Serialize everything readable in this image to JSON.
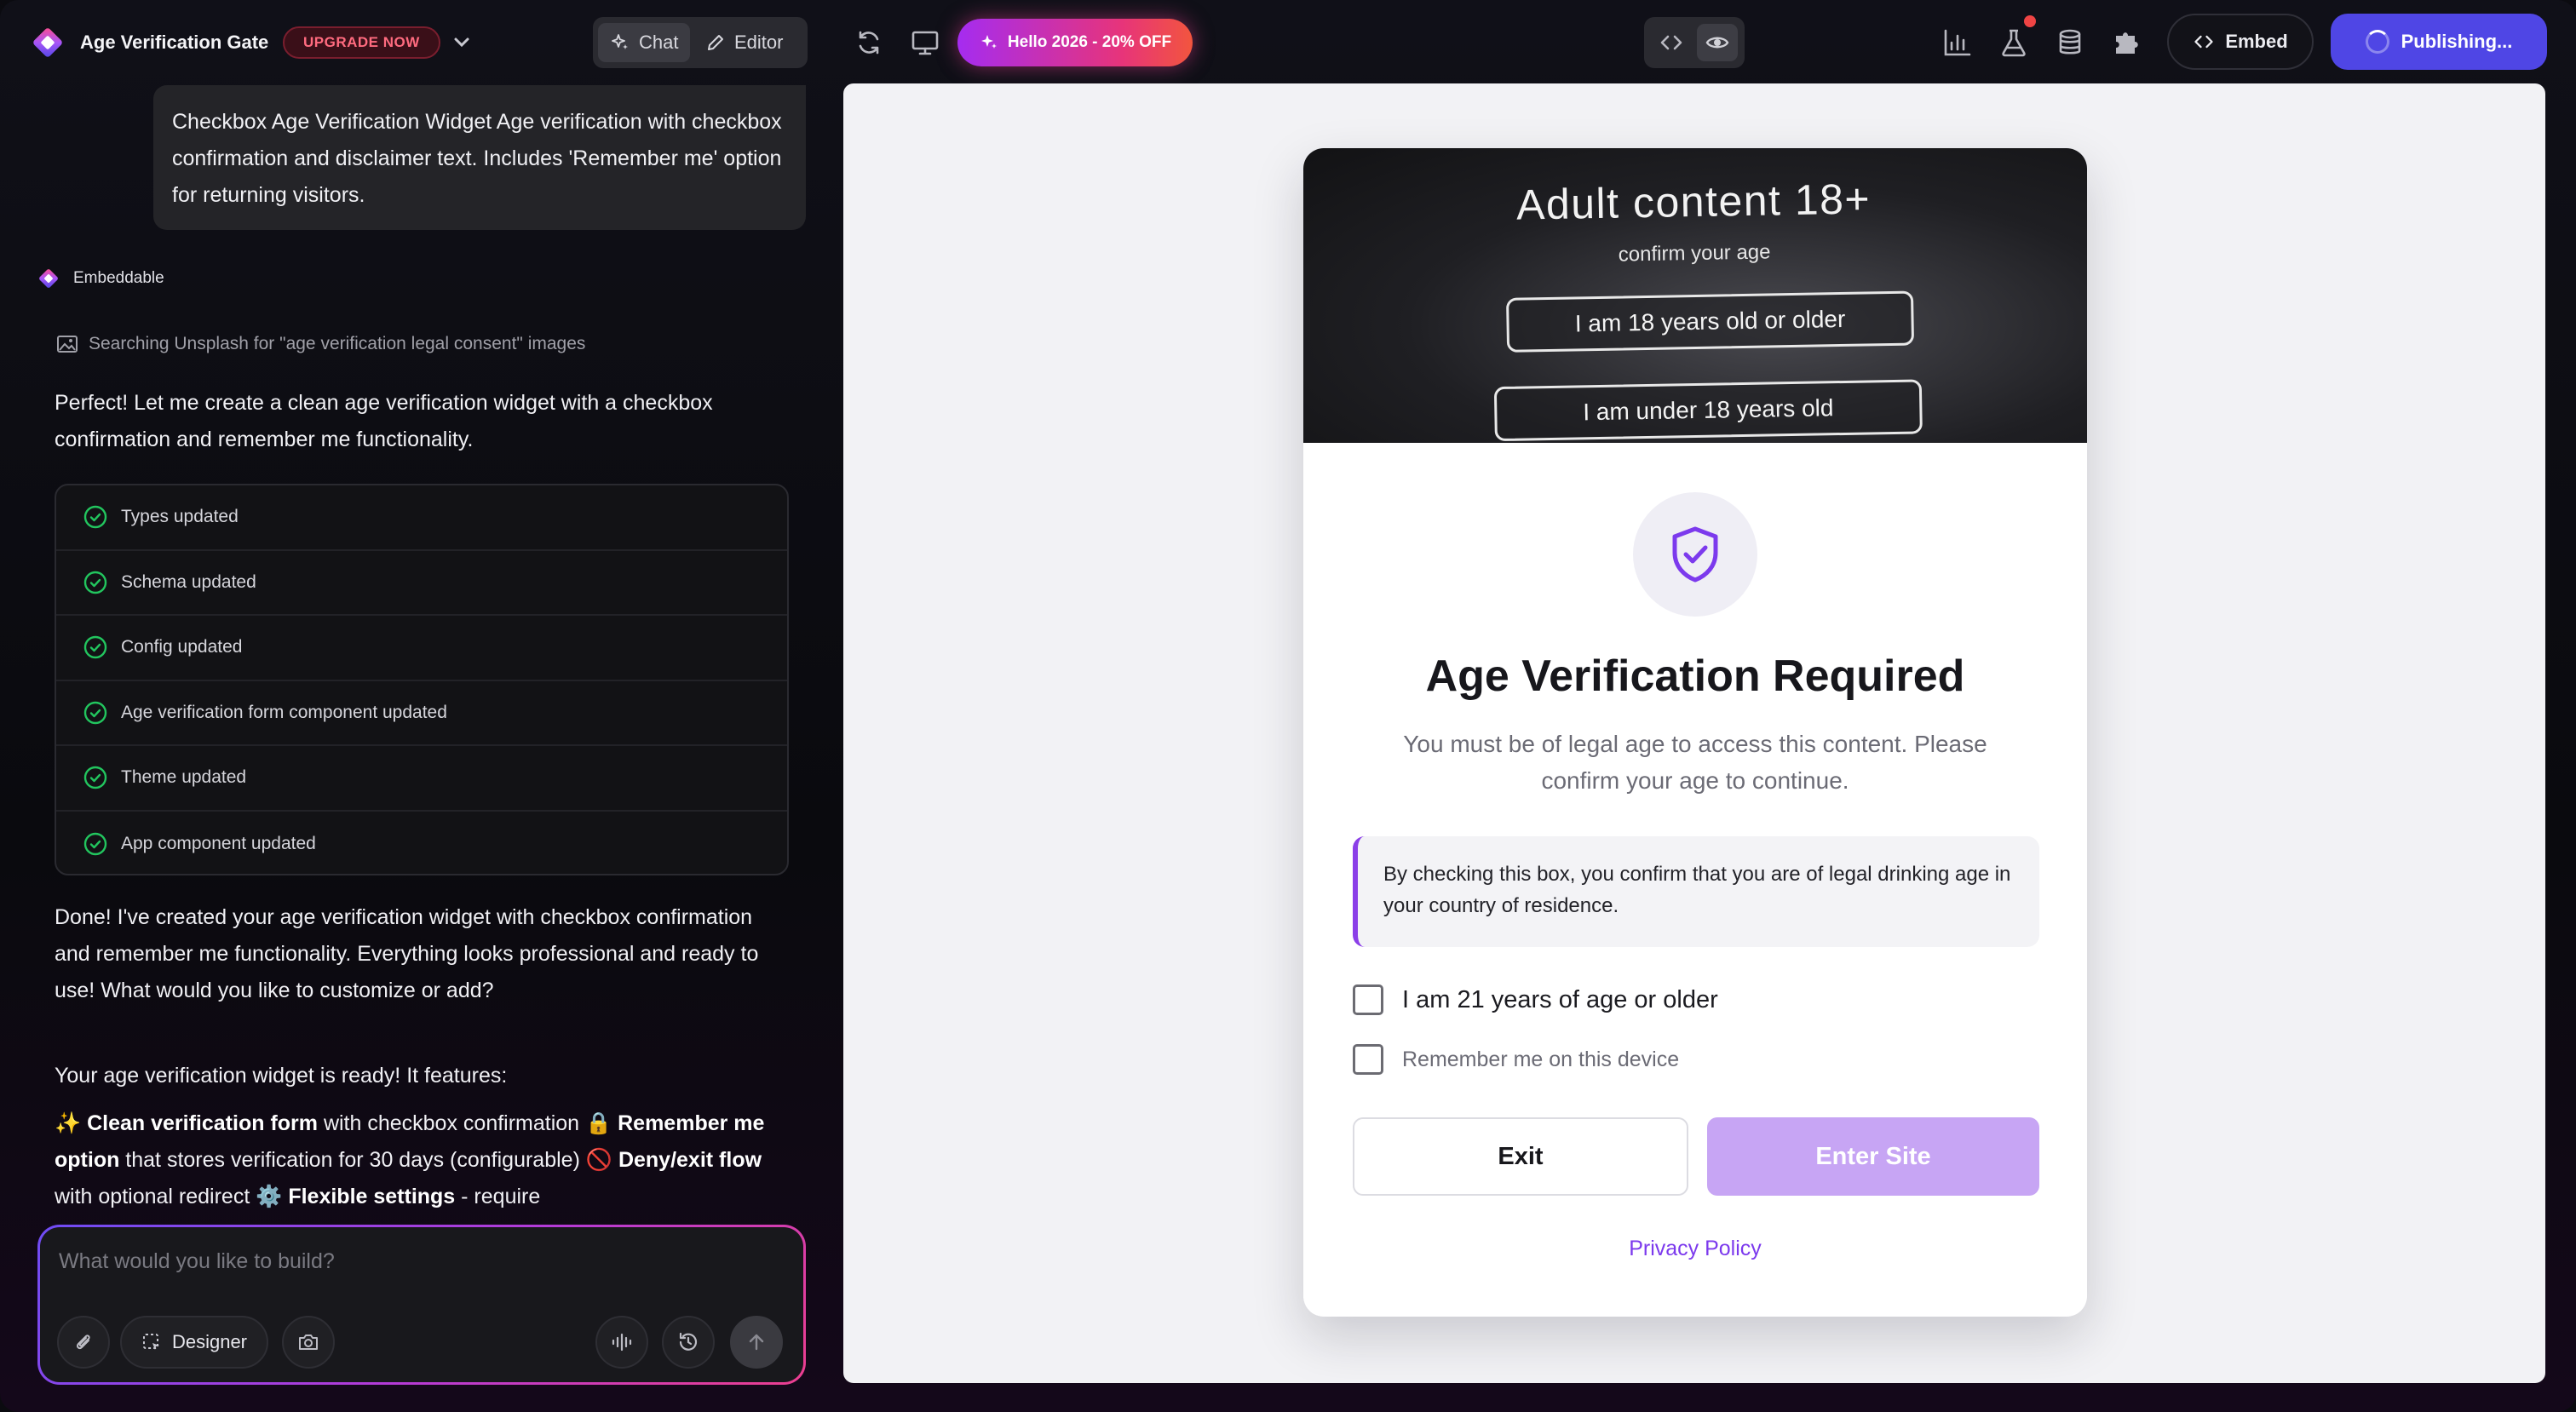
{
  "app": {
    "title": "Age Verification Gate",
    "upgrade_label": "UPGRADE NOW"
  },
  "toolbar": {
    "chat_label": "Chat",
    "editor_label": "Editor",
    "promo_label": "Hello 2026 - 20% OFF",
    "embed_label": "Embed",
    "publish_label": "Publishing...",
    "icons": [
      "refresh-icon",
      "monitor-icon",
      "code-icon",
      "eye-icon",
      "analytics-icon",
      "flask-icon",
      "database-icon",
      "puzzle-icon"
    ]
  },
  "chat": {
    "user_message": "Checkbox Age Verification Widget Age verification with checkbox confirmation and disclaimer text. Includes 'Remember me' option for returning visitors.",
    "bot_name": "Embeddable",
    "search_status": "Searching Unsplash for \"age verification legal consent\" images",
    "intro": "Perfect! Let me create a clean age verification widget with a checkbox confirmation and remember me functionality.",
    "steps": [
      "Types updated",
      "Schema updated",
      "Config updated",
      "Age verification form component updated",
      "Theme updated",
      "App component updated"
    ],
    "done_message": "Done! I've created your age verification widget with checkbox confirmation and remember me functionality. Everything looks professional and ready to use! What would you like to customize or add?",
    "ready_message": "Your age verification widget is ready! It features:",
    "features": {
      "f1_emoji": "✨",
      "f1_bold": "Clean verification form",
      "f1_text": " with checkbox confirmation ",
      "f2_emoji": "🔒",
      "f2_bold": "Remember me option",
      "f2_text": " that stores verification for 30 days (configurable) ",
      "f3_emoji": "🚫",
      "f3_bold": "Deny/exit flow",
      "f3_text": " with optional redirect ",
      "f4_emoji": "⚙️",
      "f4_bold": "Flexible settings",
      "f4_text": " - require"
    }
  },
  "composer": {
    "placeholder": "What would you like to build?",
    "designer_label": "Designer"
  },
  "widget": {
    "hero": {
      "title": "Adult content 18+",
      "subtitle": "confirm your age",
      "option_over": "I am 18 years old or older",
      "option_under": "I am under 18 years old"
    },
    "title": "Age Verification Required",
    "subtitle": "You must be of legal age to access this content. Please confirm your age to continue.",
    "disclaimer": "By checking this box, you confirm that you are of legal drinking age in your country of residence.",
    "age_checkbox_label": "I am 21 years of age or older",
    "remember_checkbox_label": "Remember me on this device",
    "exit_label": "Exit",
    "enter_label": "Enter Site",
    "privacy_label": "Privacy Policy"
  },
  "colors": {
    "accent": "#7c3aed",
    "publish": "#4f46e5",
    "success": "#22c55e",
    "upgrade": "#ff6b7f",
    "enter_disabled": "#c7a5f4"
  }
}
